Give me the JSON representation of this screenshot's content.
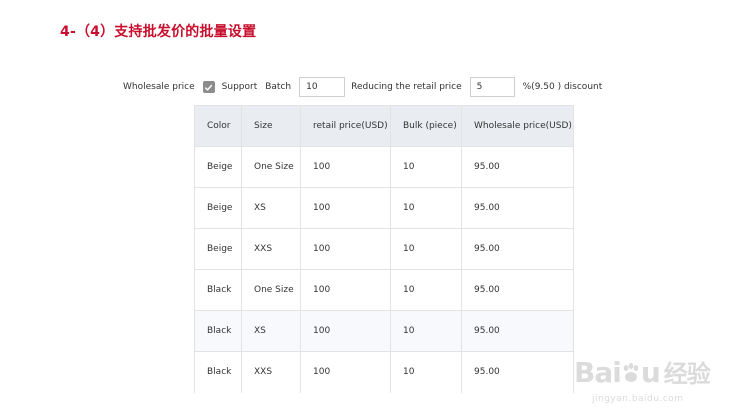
{
  "title": "4-（4）支持批发价的批量设置",
  "controls": {
    "wholesale_label": "Wholesale price",
    "support_checked": true,
    "support_label": "Support",
    "batch_label": "Batch",
    "batch_value": "10",
    "reducing_label": "Reducing the retail price",
    "reducing_value": "5",
    "discount_text": "%(9.50 ) discount"
  },
  "table": {
    "headers": [
      "Color",
      "Size",
      "retail price(USD)",
      "Bulk (piece)",
      "Wholesale price(USD)"
    ],
    "rows": [
      [
        "Beige",
        "One Size",
        "100",
        "10",
        "95.00"
      ],
      [
        "Beige",
        "XS",
        "100",
        "10",
        "95.00"
      ],
      [
        "Beige",
        "XXS",
        "100",
        "10",
        "95.00"
      ],
      [
        "Black",
        "One Size",
        "100",
        "10",
        "95.00"
      ],
      [
        "Black",
        "XS",
        "100",
        "10",
        "95.00"
      ],
      [
        "Black",
        "XXS",
        "100",
        "10",
        "95.00"
      ]
    ]
  },
  "watermark": {
    "brand": "Bai",
    "brand_end": "u",
    "cn": "经验",
    "url": "jingyan.baidu.com"
  },
  "colors": {
    "title": "#c8102e",
    "header_bg": "#e9ecf1",
    "checkbox": "#8c8c8c"
  }
}
